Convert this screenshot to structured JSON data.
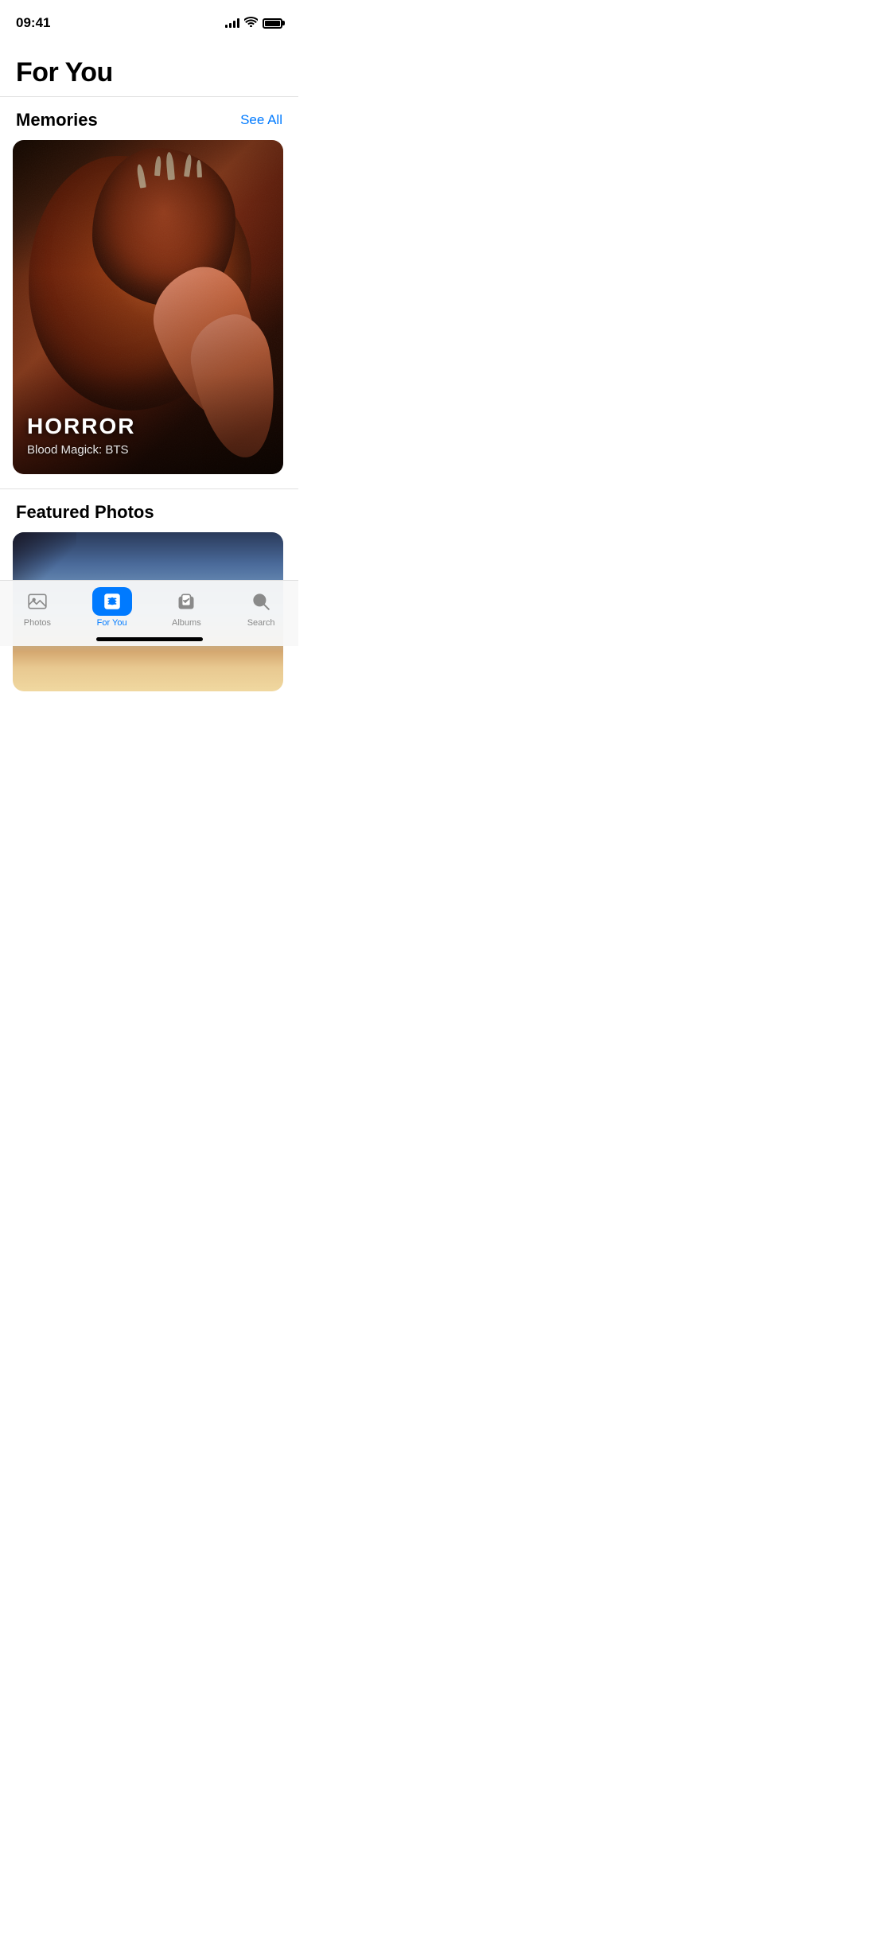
{
  "statusBar": {
    "time": "09:41"
  },
  "pageTitle": "For You",
  "memories": {
    "sectionTitle": "Memories",
    "seeAll": "See All",
    "card": {
      "genre": "HORROR",
      "subtitle": "Blood Magick: BTS"
    }
  },
  "featuredPhotos": {
    "sectionTitle": "Featured Photos"
  },
  "tabBar": {
    "tabs": [
      {
        "id": "photos",
        "label": "Photos",
        "active": false
      },
      {
        "id": "for-you",
        "label": "For You",
        "active": true
      },
      {
        "id": "albums",
        "label": "Albums",
        "active": false
      },
      {
        "id": "search",
        "label": "Search",
        "active": false
      }
    ]
  }
}
